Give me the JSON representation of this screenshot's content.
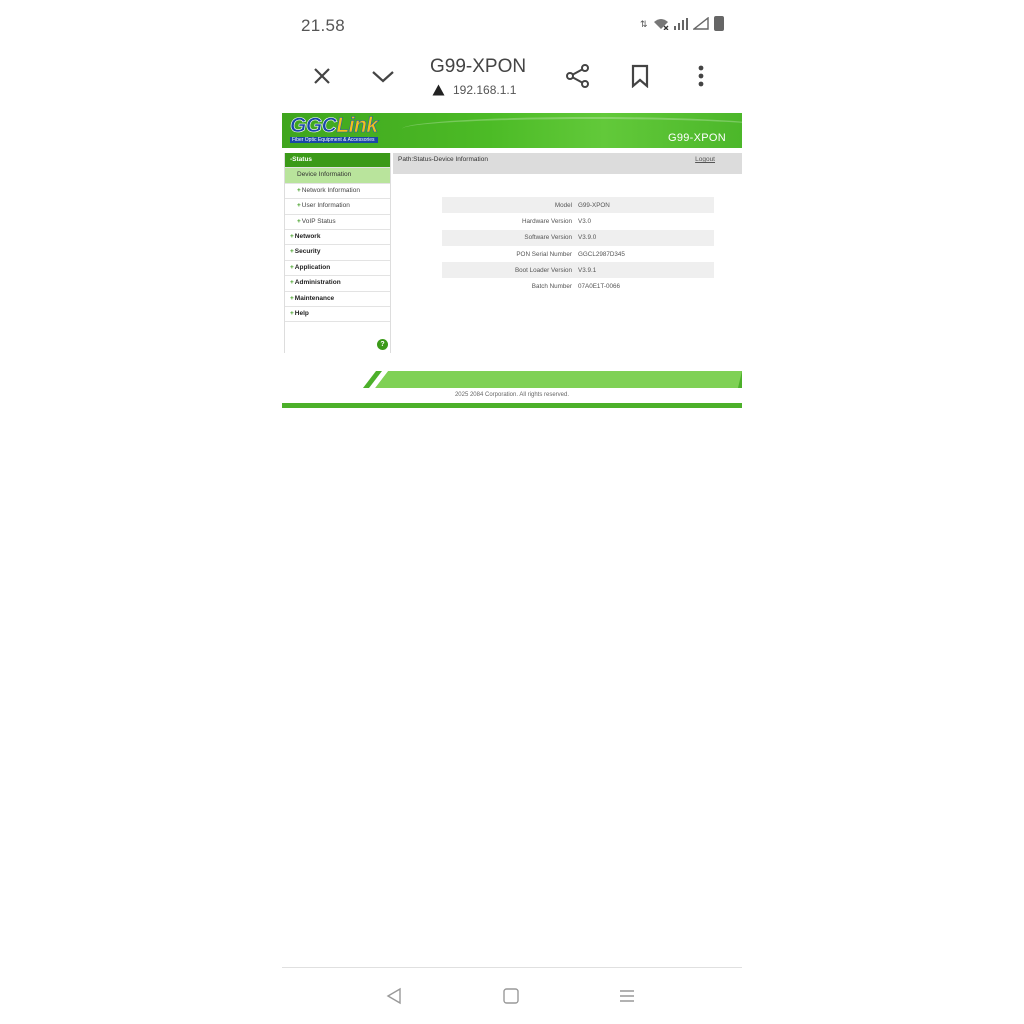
{
  "status_bar": {
    "time": "21.58"
  },
  "toolbar": {
    "title": "G99-XPON",
    "url": "192.168.1.1",
    "icons": [
      "close-icon",
      "chevron-down-icon",
      "share-icon",
      "bookmark-icon",
      "more-vert-icon"
    ]
  },
  "router": {
    "logo_main": "GGC",
    "logo_accent": "Link",
    "logo_tagline": "Fiber Optic Equipment & Accessories",
    "model": "G99-XPON",
    "path": "Path:Status-Device Information",
    "logout": "Logout",
    "nav": [
      {
        "label": "-Status",
        "kind": "active-head"
      },
      {
        "label": "Device Information",
        "kind": "active-sub"
      },
      {
        "label": "Network Information",
        "kind": "sub"
      },
      {
        "label": "User Information",
        "kind": "sub"
      },
      {
        "label": "VoIP Status",
        "kind": "sub"
      },
      {
        "label": "Network",
        "kind": "top"
      },
      {
        "label": "Security",
        "kind": "top"
      },
      {
        "label": "Application",
        "kind": "top"
      },
      {
        "label": "Administration",
        "kind": "top"
      },
      {
        "label": "Maintenance",
        "kind": "top"
      },
      {
        "label": "Help",
        "kind": "top"
      }
    ],
    "info": [
      {
        "label": "Model",
        "value": "G99-XPON"
      },
      {
        "label": "Hardware Version",
        "value": "V3.0"
      },
      {
        "label": "Software Version",
        "value": "V3.9.0"
      },
      {
        "label": "PON Serial Number",
        "value": "GGCL2987D345"
      },
      {
        "label": "Boot Loader Version",
        "value": "V3.9.1"
      },
      {
        "label": "Batch Number",
        "value": "07A0E1T-0066"
      }
    ],
    "footer": "2025 2084 Corporation. All rights reserved."
  },
  "colors": {
    "brand_green": "#4cb02a",
    "active_nav": "#3b9a18",
    "active_sub": "#b9e49c"
  }
}
